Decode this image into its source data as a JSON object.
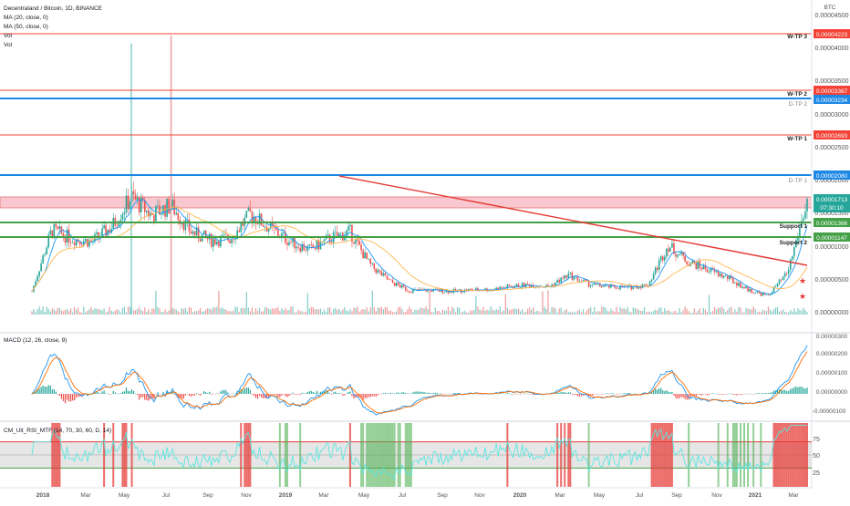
{
  "header": {
    "title": "Decentraland / Bitcoin, 1D, BINANCE",
    "indicators": [
      "MA (20, close, 0)",
      "MA (50, close, 0)",
      "Vol",
      "Vol"
    ],
    "currency": "BTC"
  },
  "price_axis": {
    "ticks": [
      "0.00004500",
      "0.00004000",
      "0.00003500",
      "0.00003000",
      "0.00002500",
      "0.00002000",
      "0.00001500",
      "0.00001000",
      "0.00000500",
      "0.00000000"
    ]
  },
  "levels": [
    {
      "price": "0.00004223",
      "label": "W-TP 3",
      "kind": "red"
    },
    {
      "price": "0.00003367",
      "label": "W-TP 2",
      "kind": "red"
    },
    {
      "price": "0.00003234",
      "label": "D-TP 2",
      "kind": "blue"
    },
    {
      "price": "0.00002693",
      "label": "W-TP 1",
      "kind": "red"
    },
    {
      "price": "0.00002080",
      "label": "D-TP 1",
      "kind": "blue"
    },
    {
      "price": "0.00001366",
      "label": "Support 1",
      "kind": "green"
    },
    {
      "price": "0.00001147",
      "label": "Support 2",
      "kind": "green"
    }
  ],
  "current_price": {
    "price": "0.00001713",
    "countdown": "07:30:10"
  },
  "macd": {
    "title": "MACD (12, 26, close, 9)",
    "ticks": [
      "0.00000300",
      "0.00000200",
      "0.00000100",
      "0.00000000",
      "-0.00000100"
    ]
  },
  "rsi": {
    "title": "CM_Ult_RSI_MTF (14, 70, 30, 60, D, 14)",
    "ticks": [
      "75",
      "50",
      "25"
    ]
  },
  "time_axis": [
    "2018",
    "Mar",
    "May",
    "Jul",
    "Sep",
    "Nov",
    "2019",
    "Mar",
    "May",
    "Jul",
    "Sep",
    "Nov",
    "2020",
    "Mar",
    "May",
    "Jul",
    "Sep",
    "Nov",
    "2021",
    "Mar"
  ],
  "colors": {
    "candle_up": "#26a69a",
    "candle_down": "#ef5350",
    "ma20": "#2196f3",
    "ma50": "#ffb74d",
    "red_level": "#f44336",
    "blue_level": "#1e88e5",
    "green_level": "#43a047",
    "resistance_zone": "#f8c7cf",
    "trendline": "#e53935",
    "macd_line": "#2196f3",
    "signal_line": "#ff6d00",
    "rsi_line": "#5ce6e0",
    "current_price": "#26a69a"
  },
  "chart_data": {
    "type": "line",
    "title": "Decentraland / Bitcoin, 1D, BINANCE",
    "xlabel": "",
    "ylabel": "BTC",
    "ylim": [
      0,
      4.65e-05
    ],
    "x": [
      "2017-12",
      "2018-01",
      "2018-02",
      "2018-03",
      "2018-04",
      "2018-05",
      "2018-06",
      "2018-07",
      "2018-08",
      "2018-09",
      "2018-10",
      "2018-11",
      "2018-12",
      "2019-01",
      "2019-02",
      "2019-03",
      "2019-04",
      "2019-05",
      "2019-06",
      "2019-07",
      "2019-08",
      "2019-09",
      "2019-10",
      "2019-11",
      "2019-12",
      "2020-01",
      "2020-02",
      "2020-03",
      "2020-04",
      "2020-05",
      "2020-06",
      "2020-07",
      "2020-08",
      "2020-09",
      "2020-10",
      "2020-11",
      "2020-12",
      "2021-01",
      "2021-02",
      "2021-03"
    ],
    "series": [
      {
        "name": "",
        "values": [
          3.5e-06,
          1.28e-05,
          1.15e-05,
          1.1e-05,
          1.32e-05,
          1.78e-05,
          1.5e-05,
          1.65e-05,
          1.25e-05,
          1.12e-05,
          1.15e-05,
          1.52e-05,
          1.3e-05,
          1.1e-05,
          9.8e-06,
          1.15e-05,
          1.25e-05,
          7.5e-06,
          5e-06,
          3.6e-06,
          3.7e-06,
          3.5e-06,
          3.7e-06,
          3.8e-06,
          4.2e-06,
          4.5e-06,
          4.2e-06,
          6e-06,
          4.6e-06,
          4.2e-06,
          4.1e-06,
          4.5e-06,
          1.05e-05,
          8e-06,
          6.8e-06,
          5.5e-06,
          3.8e-06,
          2.8e-06,
          6.2e-06,
          1.71e-05
        ]
      }
    ],
    "volume_spikes": [
      {
        "x": "2018-05",
        "value": 4.1e-05
      },
      {
        "x": "2018-07",
        "value": 4.22e-05
      }
    ],
    "horizontal_levels": [
      4.223e-05,
      3.367e-05,
      3.234e-05,
      2.693e-05,
      2.08e-05,
      1.366e-05,
      1.147e-05
    ],
    "resistance_zone": [
      1.62e-05,
      1.75e-05
    ],
    "trendline": {
      "from": {
        "x": "2019-04",
        "y": 2.08e-05
      },
      "to": {
        "x": "2021-03",
        "y": 6.8e-06
      }
    },
    "grid": false,
    "legend": "top-left"
  }
}
